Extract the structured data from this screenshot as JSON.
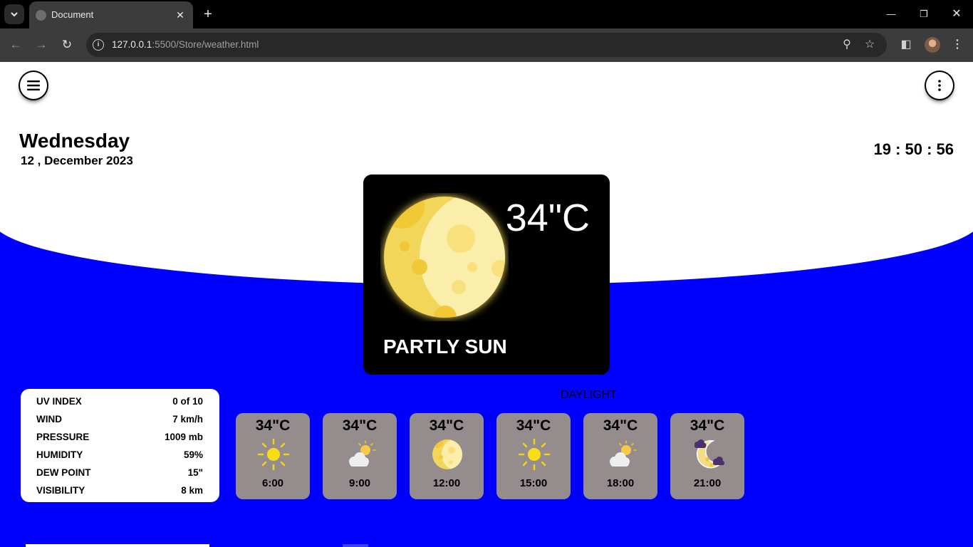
{
  "browser": {
    "tab_title": "Document",
    "url_host": "127.0.0.1",
    "url_rest": ":5500/Store/weather.html"
  },
  "header": {
    "day": "Wednesday",
    "date": "12 , December 2023",
    "time": "19 : 50 : 56"
  },
  "current": {
    "temperature": "34\"C",
    "condition": "PARTLY SUN",
    "icon": "moon-icon"
  },
  "details": [
    {
      "label": "UV INDEX",
      "value": "0 of 10"
    },
    {
      "label": "WIND",
      "value": "7 km/h"
    },
    {
      "label": "PRESSURE",
      "value": "1009 mb"
    },
    {
      "label": "HUMIDITY",
      "value": "59%"
    },
    {
      "label": "DEW POINT",
      "value": "15\""
    },
    {
      "label": "VISIBILITY",
      "value": "8 km"
    }
  ],
  "daylight_label": "DAYLIGHT",
  "hourly": [
    {
      "temp": "34\"C",
      "time": "6:00",
      "icon": "sun-icon"
    },
    {
      "temp": "34\"C",
      "time": "9:00",
      "icon": "cloud-sun-icon"
    },
    {
      "temp": "34\"C",
      "time": "12:00",
      "icon": "moon-icon"
    },
    {
      "temp": "34\"C",
      "time": "15:00",
      "icon": "sun-icon"
    },
    {
      "temp": "34\"C",
      "time": "18:00",
      "icon": "cloud-sun-icon"
    },
    {
      "temp": "34\"C",
      "time": "21:00",
      "icon": "cloudy-moon-icon"
    }
  ],
  "colors": {
    "background_accent": "#0000ff",
    "card_dark": "#000000",
    "hour_card": "#958d8d"
  }
}
